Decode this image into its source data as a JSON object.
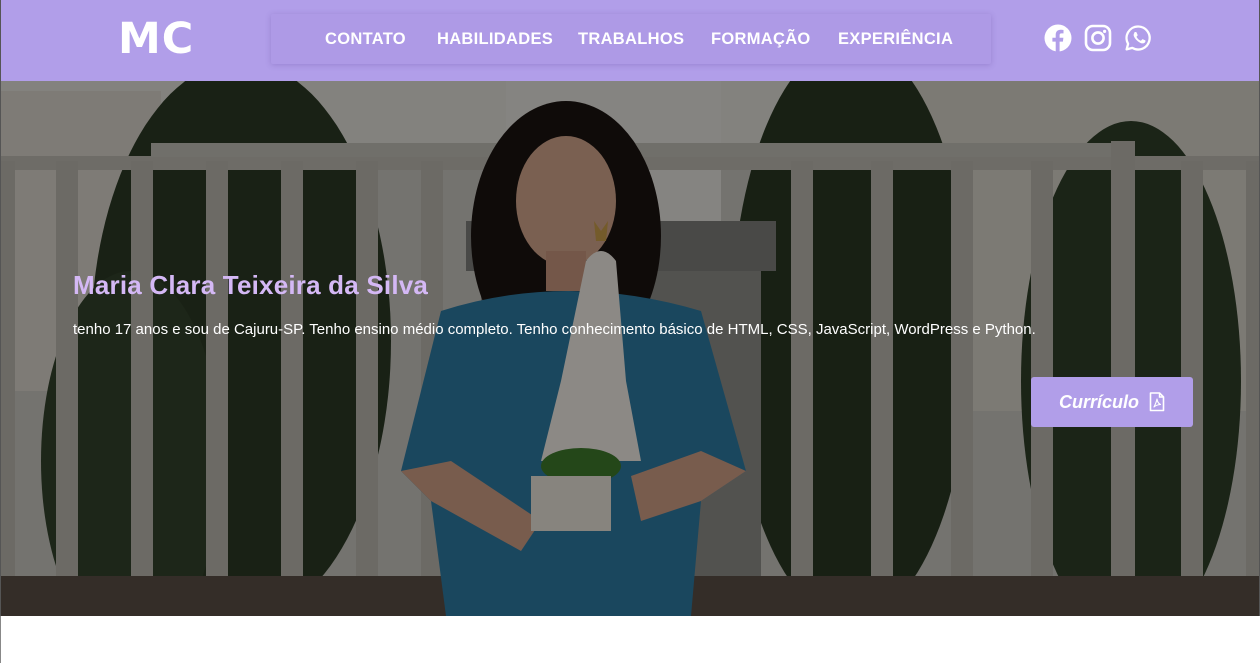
{
  "header": {
    "logo": "MC",
    "nav": [
      {
        "label": "CONTATO"
      },
      {
        "label": "HABILIDADES"
      },
      {
        "label": "TRABALHOS"
      },
      {
        "label": "FORMAÇÃO"
      },
      {
        "label": "EXPERIÊNCIA"
      }
    ],
    "social": [
      {
        "icon": "facebook-icon"
      },
      {
        "icon": "instagram-icon"
      },
      {
        "icon": "whatsapp-icon"
      }
    ]
  },
  "hero": {
    "name": "Maria Clara Teixeira da Silva",
    "description": "tenho 17 anos e sou de Cajuru-SP. Tenho ensino médio completo. Tenho conhecimento básico de HTML, CSS, JavaScript, WordPress e Python.",
    "cv_button": "Currículo",
    "cv_icon": "pdf-file-icon"
  },
  "colors": {
    "accent": "#b19ee9",
    "title": "#d4b8f5"
  }
}
